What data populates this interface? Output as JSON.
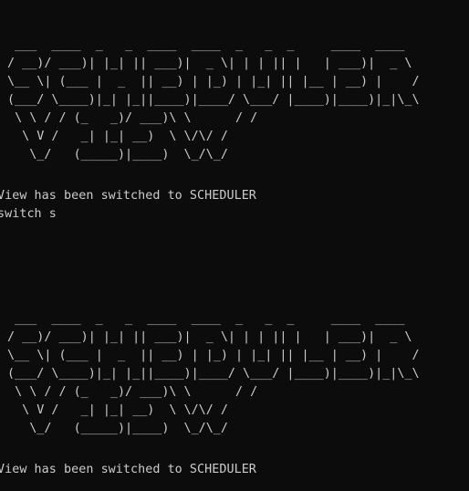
{
  "console": {
    "banner_art": "  ___  ____  _   _  ____  ____  _   _  _     ____  ____\n / __)/ ___)| |_| || ___)|  _ \\| | | || |   | ___)|  _ \\\n \\__ \\| (___ |  _  || __) | |_) | |_| || |__ | __) |    /\n (___/ \\____)|_| |_||____)|____/ \\___/ |____)|____)|_|\\_\\\n  \\ \\ / / (_   _)/ ___)\\ \\      / /\n   \\ V /   _| |_| __)  \\ \\/\\/ /\n    \\_/   (_____)|____)  \\_/\\_/",
    "lines": [
      "View has been switched to SCHEDULER",
      "switch s",
      "View has been switched to SCHEDULER"
    ]
  }
}
